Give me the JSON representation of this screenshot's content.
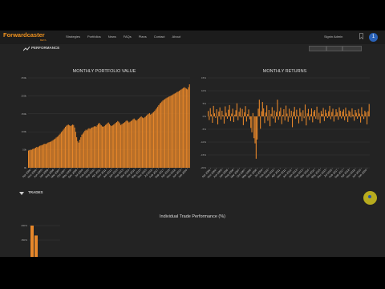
{
  "nav": {
    "logo": "Forwardcaster",
    "logo_sub": "BETA",
    "items": [
      "Strategies",
      "Portfolios",
      "News",
      "FAQs",
      "Plans",
      "Contact",
      "About"
    ],
    "user": "Signin Admin",
    "avatar": "1"
  },
  "sections": {
    "performance": "PERFORMANCE",
    "trades": "TRADES"
  },
  "colors": {
    "bar": "#e7872a",
    "background": "#232323",
    "grid": "#3a3a3a"
  },
  "chart_data": [
    {
      "type": "bar",
      "title": "MONTHLY PORTFOLIO VALUE",
      "ylim": [
        0,
        250
      ],
      "yticks": [
        "0k",
        "50k",
        "100k",
        "150k",
        "200k",
        "250k"
      ],
      "x_ticks": [
        "Apr 2004",
        "Nov 2004",
        "Jun 2005",
        "Jan 2006",
        "Aug 2006",
        "Mar 2007",
        "Oct 2007",
        "May 2008",
        "Dec 2008",
        "Jul 2009",
        "Feb 2010",
        "Sep 2010",
        "Apr 2011",
        "Nov 2011",
        "Jun 2012",
        "Jan 2013",
        "Aug 2013",
        "Mar 2014",
        "Oct 2014",
        "May 2015",
        "Dec 2015",
        "Jul 2016",
        "Feb 2017",
        "Sep 2017",
        "Apr 2018",
        "Nov 2018",
        "Jun 2019",
        "Jan 2020"
      ],
      "values": [
        48,
        49,
        50,
        50,
        52,
        53,
        54,
        56,
        58,
        57,
        59,
        61,
        62,
        63,
        64,
        66,
        67,
        66,
        68,
        70,
        71,
        72,
        73,
        75,
        77,
        79,
        81,
        84,
        86,
        88,
        92,
        95,
        99,
        102,
        106,
        110,
        114,
        117,
        119,
        120,
        118,
        116,
        118,
        120,
        119,
        112,
        100,
        85,
        74,
        70,
        78,
        85,
        92,
        95,
        99,
        103,
        106,
        104,
        108,
        110,
        108,
        111,
        112,
        113,
        115,
        116,
        114,
        118,
        122,
        125,
        121,
        118,
        115,
        114,
        116,
        119,
        121,
        124,
        126,
        122,
        118,
        116,
        118,
        120,
        122,
        125,
        127,
        130,
        128,
        124,
        119,
        121,
        123,
        125,
        127,
        130,
        132,
        129,
        126,
        128,
        130,
        132,
        135,
        137,
        134,
        131,
        133,
        136,
        138,
        141,
        143,
        140,
        138,
        140,
        142,
        145,
        148,
        150,
        152,
        148,
        150,
        153,
        155,
        158,
        162,
        166,
        170,
        174,
        178,
        181,
        184,
        187,
        189,
        191,
        193,
        195,
        196,
        198,
        199,
        201,
        202,
        204,
        206,
        207,
        209,
        211,
        212,
        214,
        216,
        218,
        220,
        222,
        224,
        222,
        220,
        218,
        224,
        232
      ]
    },
    {
      "type": "bar",
      "title": "MONTHLY RETURNS",
      "ylim": [
        -20,
        15
      ],
      "yticks": [
        "-20%",
        "-15%",
        "-10%",
        "-5%",
        "0%",
        "5%",
        "10%",
        "15%"
      ],
      "x_ticks": [
        "Apr 2004",
        "Nov 2004",
        "Jun 2005",
        "Jan 2006",
        "Aug 2006",
        "Mar 2007",
        "Oct 2007",
        "May 2008",
        "Dec 2008",
        "Jul 2009",
        "Feb 2010",
        "Sep 2010",
        "Apr 2011",
        "Nov 2011",
        "Jun 2012",
        "Jan 2013",
        "Aug 2013",
        "Mar 2014",
        "Oct 2014",
        "May 2015",
        "Dec 2015",
        "Jul 2016",
        "Feb 2017",
        "Sep 2017",
        "Apr 2018",
        "Nov 2018",
        "Jun 2019",
        "Jan 2020"
      ],
      "values": [
        2.1,
        -1.4,
        3.2,
        0.8,
        -2.5,
        4.1,
        1.2,
        -0.6,
        2.8,
        -3.1,
        1.9,
        3.5,
        -1.2,
        2.2,
        0.5,
        -2.8,
        3.9,
        1.4,
        -0.9,
        2.6,
        4.4,
        -1.8,
        1.1,
        3.0,
        -2.2,
        0.7,
        2.4,
        5.1,
        -1.5,
        1.8,
        3.3,
        -0.4,
        2.9,
        -3.4,
        1.6,
        4.0,
        -2.0,
        0.9,
        2.7,
        -1.1,
        -4.5,
        -6.2,
        1.3,
        -8.5,
        -10.5,
        -16.5,
        -9.0,
        3.0,
        6.5,
        -4.8,
        2.0,
        5.6,
        3.1,
        -2.6,
        1.5,
        4.3,
        -1.7,
        2.5,
        -3.8,
        1.0,
        3.6,
        -0.8,
        2.3,
        -2.4,
        1.7,
        6.5,
        -1.3,
        2.0,
        3.4,
        -3.0,
        0.6,
        2.8,
        -1.6,
        4.2,
        1.1,
        -2.1,
        3.0,
        -0.5,
        2.2,
        -4.2,
        1.8,
        3.7,
        -1.0,
        2.6,
        0.4,
        -2.7,
        3.2,
        1.5,
        -1.9,
        2.4,
        -0.7,
        4.6,
        -3.5,
        1.2,
        2.9,
        -1.4,
        0.8,
        3.1,
        -2.3,
        1.9,
        2.5,
        -0.9,
        3.8,
        -1.2,
        1.4,
        -2.6,
        2.1,
        0.9,
        3.3,
        -1.8,
        2.6,
        1.3,
        -0.6,
        2.0,
        4.1,
        -1.1,
        1.7,
        3.0,
        -2.0,
        0.5,
        2.8,
        1.6,
        -1.3,
        3.5,
        2.2,
        -0.8,
        1.9,
        2.7,
        -1.5,
        3.4,
        1.0,
        -2.2,
        2.3,
        1.8,
        -0.4,
        3.1,
        0.7,
        -1.7,
        2.5,
        1.4,
        -0.9,
        2.9,
        1.1,
        -2.4,
        3.6,
        0.8,
        -1.0,
        2.2,
        1.6,
        -3.1,
        2.0,
        4.8
      ]
    },
    {
      "type": "bar",
      "title": "Individual Trade Performance (%)",
      "yticks": [
        "200%",
        "150%"
      ],
      "values": [
        200,
        145
      ]
    }
  ]
}
